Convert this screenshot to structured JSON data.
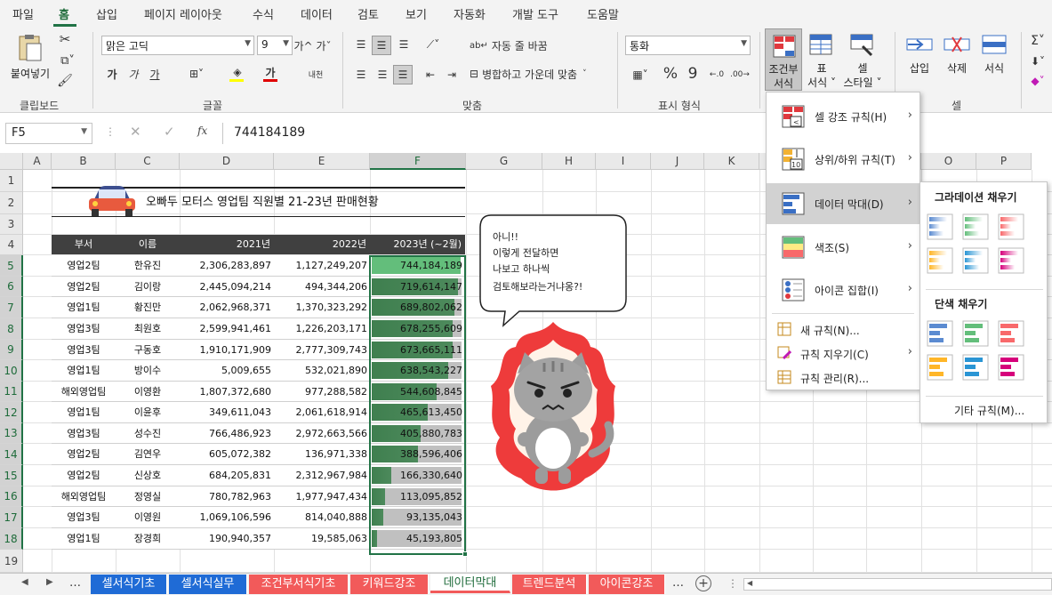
{
  "menu_tabs": [
    "파일",
    "홈",
    "삽입",
    "페이지 레이아웃",
    "수식",
    "데이터",
    "검토",
    "보기",
    "자동화",
    "개발 도구",
    "도움말"
  ],
  "active_tab": "홈",
  "ribbon": {
    "clipboard": {
      "paste_label": "붙여넣기",
      "group_label": "클립보드"
    },
    "font": {
      "font_name": "맑은 고딕",
      "font_size": "9",
      "bold": "가",
      "italic": "가",
      "underline": "가",
      "grow": "가^",
      "shrink": "가ˇ",
      "font_color_glyph": "가",
      "phonetic": "내천",
      "group_label": "글꼴"
    },
    "alignment": {
      "wrap_text": "자동 줄 바꿈",
      "merge_center": "병합하고 가운데 맞춤",
      "group_label": "맞춤"
    },
    "number": {
      "format": "통화",
      "percent": "%",
      "comma": "9",
      "group_label": "표시 형식"
    },
    "styles": {
      "conditional_line1": "조건부",
      "conditional_line2": "서식",
      "table_line1": "표",
      "table_line2": "서식",
      "cell_line1": "셀",
      "cell_line2": "스타일"
    },
    "cells": {
      "insert": "삽입",
      "delete": "삭제",
      "format": "서식",
      "group_label": "셀"
    },
    "editing": {
      "sum": "Σ"
    }
  },
  "formula_bar": {
    "name_box": "F5",
    "fx": "fx",
    "value": "744184189"
  },
  "columns": [
    "A",
    "B",
    "C",
    "D",
    "E",
    "F",
    "G",
    "H",
    "I",
    "J",
    "K",
    "L",
    "M",
    "N",
    "O",
    "P"
  ],
  "rows": [
    "1",
    "2",
    "3",
    "4",
    "5",
    "6",
    "7",
    "8",
    "9",
    "10",
    "11",
    "12",
    "13",
    "14",
    "15",
    "16",
    "17",
    "18",
    "19"
  ],
  "sheet": {
    "title": "오빠두 모터스 영업팀 직원별 21-23년 판매현황",
    "headers": [
      "부서",
      "이름",
      "2021년",
      "2022년",
      "2023년 (~2월)"
    ],
    "records": [
      {
        "dept": "영업2팀",
        "name": "한유진",
        "y2021": "2,306,283,897",
        "y2022": "1,127,249,207",
        "y2023": "744,184,189",
        "v": 744184189
      },
      {
        "dept": "영업2팀",
        "name": "김이랑",
        "y2021": "2,445,094,214",
        "y2022": "494,344,206",
        "y2023": "719,614,147",
        "v": 719614147
      },
      {
        "dept": "영업1팀",
        "name": "황진만",
        "y2021": "2,062,968,371",
        "y2022": "1,370,323,292",
        "y2023": "689,802,062",
        "v": 689802062
      },
      {
        "dept": "영업3팀",
        "name": "최원호",
        "y2021": "2,599,941,461",
        "y2022": "1,226,203,171",
        "y2023": "678,255,609",
        "v": 678255609
      },
      {
        "dept": "영업3팀",
        "name": "구동호",
        "y2021": "1,910,171,909",
        "y2022": "2,777,309,743",
        "y2023": "673,665,111",
        "v": 673665111
      },
      {
        "dept": "영업1팀",
        "name": "방이수",
        "y2021": "5,009,655",
        "y2022": "532,021,890",
        "y2023": "638,543,227",
        "v": 638543227
      },
      {
        "dept": "해외영업팀",
        "name": "이영환",
        "y2021": "1,807,372,680",
        "y2022": "977,288,582",
        "y2023": "544,608,845",
        "v": 544608845
      },
      {
        "dept": "영업1팀",
        "name": "이윤후",
        "y2021": "349,611,043",
        "y2022": "2,061,618,914",
        "y2023": "465,613,450",
        "v": 465613450
      },
      {
        "dept": "영업3팀",
        "name": "성수진",
        "y2021": "766,486,923",
        "y2022": "2,972,663,566",
        "y2023": "405,880,783",
        "v": 405880783
      },
      {
        "dept": "영업2팀",
        "name": "김연우",
        "y2021": "605,072,382",
        "y2022": "136,971,338",
        "y2023": "388,596,406",
        "v": 388596406
      },
      {
        "dept": "영업2팀",
        "name": "신상호",
        "y2021": "684,205,831",
        "y2022": "2,312,967,984",
        "y2023": "166,330,640",
        "v": 166330640
      },
      {
        "dept": "해외영업팀",
        "name": "정영실",
        "y2021": "780,782,963",
        "y2022": "1,977,947,434",
        "y2023": "113,095,852",
        "v": 113095852
      },
      {
        "dept": "영업3팀",
        "name": "이영원",
        "y2021": "1,069,106,596",
        "y2022": "814,040,888",
        "y2023": "93,135,043",
        "v": 93135043
      },
      {
        "dept": "영업1팀",
        "name": "장경희",
        "y2021": "190,940,357",
        "y2022": "19,585,063",
        "y2023": "45,193,805",
        "v": 45193805
      }
    ]
  },
  "speech_bubble": [
    "아니!!",
    "이렇게 전달하면",
    "나보고 하나씩",
    "검토해보라는거냐옹?!"
  ],
  "cf_menu": [
    {
      "label": "셀 강조 규칙(H)",
      "icon": "highlight-rules-icon"
    },
    {
      "label": "상위/하위 규칙(T)",
      "icon": "top-bottom-rules-icon"
    },
    {
      "label": "데이터 막대(D)",
      "icon": "data-bars-icon"
    },
    {
      "label": "색조(S)",
      "icon": "color-scales-icon"
    },
    {
      "label": "아이콘 집합(I)",
      "icon": "icon-sets-icon"
    }
  ],
  "cf_menu_small": [
    "새 규칙(N)...",
    "규칙 지우기(C)",
    "규칙 관리(R)..."
  ],
  "databar_submenu": {
    "gradient_title": "그라데이션 채우기",
    "solid_title": "단색 채우기",
    "more_rules": "기타 규칙(M)...",
    "colors": [
      "#5b8bd1",
      "#63be7b",
      "#f8696b",
      "#ffb628",
      "#2a95d4",
      "#d6007b"
    ]
  },
  "sheet_tabs": [
    {
      "label": "셀서식기초",
      "color": "#1f6bd6"
    },
    {
      "label": "셀서식실무",
      "color": "#1f6bd6"
    },
    {
      "label": "조건부서식기초",
      "color": "#f25a5a"
    },
    {
      "label": "키워드강조",
      "color": "#f25a5a"
    },
    {
      "label": "데이터막대",
      "color": "#f25a5a",
      "active": true
    },
    {
      "label": "트렌드분석",
      "color": "#f25a5a"
    },
    {
      "label": "아이콘강조",
      "color": "#f25a5a"
    }
  ],
  "colors": {
    "excel_green": "#217346",
    "databar_green": "#63be7b",
    "databar_gray": "#c0c0c0"
  }
}
